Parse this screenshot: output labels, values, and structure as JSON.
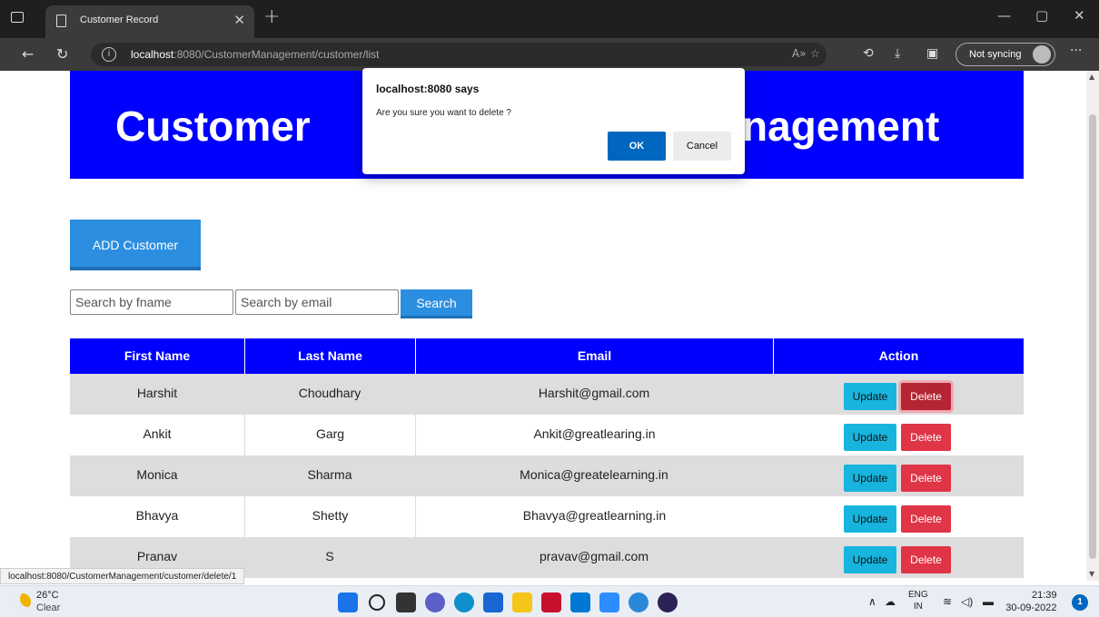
{
  "browser": {
    "tab_title": "Customer Record",
    "url_host": "localhost",
    "url_rest": ":8080/CustomerManagement/customer/list",
    "profile_label": "Not syncing",
    "status_url": "localhost:8080/CustomerManagement/customer/delete/1"
  },
  "page": {
    "header_left": "Customer",
    "header_right": "nagement",
    "add_button": "ADD Customer",
    "search_fname_placeholder": "Search by fname",
    "search_email_placeholder": "Search by email",
    "search_button": "Search"
  },
  "table": {
    "headers": [
      "First Name",
      "Last Name",
      "Email",
      "Action"
    ],
    "rows": [
      {
        "first": "Harshit",
        "last": "Choudhary",
        "email": "Harshit@gmail.com"
      },
      {
        "first": "Ankit",
        "last": "Garg",
        "email": "Ankit@greatlearing.in"
      },
      {
        "first": "Monica",
        "last": "Sharma",
        "email": "Monica@greatelearning.in"
      },
      {
        "first": "Bhavya",
        "last": "Shetty",
        "email": "Bhavya@greatlearning.in"
      },
      {
        "first": "Pranav",
        "last": "S",
        "email": "pravav@gmail.com"
      }
    ],
    "update_label": "Update",
    "delete_label": "Delete"
  },
  "dialog": {
    "title": "localhost:8080 says",
    "message": "Are you sure you want to delete ?",
    "ok": "OK",
    "cancel": "Cancel"
  },
  "taskbar": {
    "temp": "26°C",
    "weather": "Clear",
    "lang_top": "ENG",
    "lang_bottom": "IN",
    "time": "21:39",
    "date": "30-09-2022",
    "notifications": "1"
  },
  "colors": {
    "header_blue": "#0000ff",
    "primary_button": "#2b8ee0",
    "update_button": "#17b5de",
    "delete_button": "#e03547",
    "dialog_ok": "#0067c0"
  }
}
